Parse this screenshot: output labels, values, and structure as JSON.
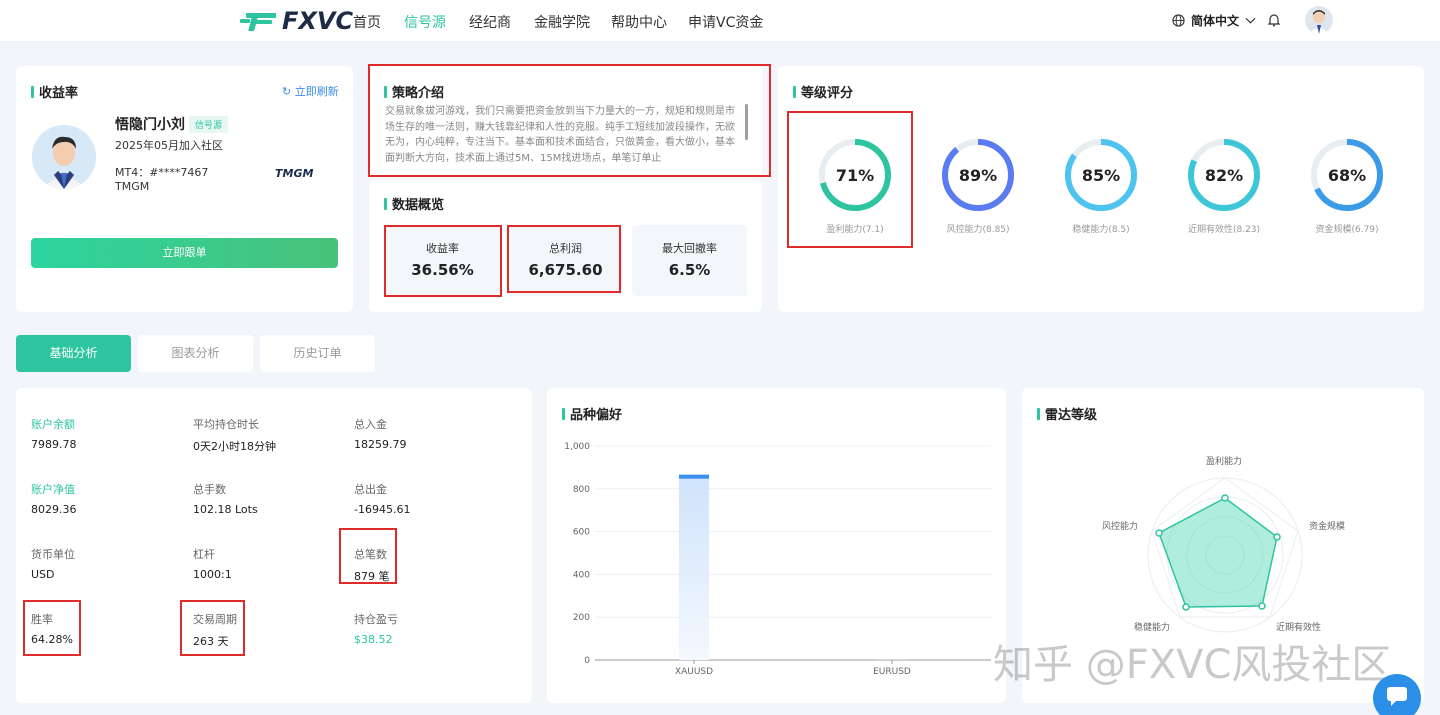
{
  "nav": {
    "logo_text": "FXVC",
    "items": [
      "首页",
      "信号源",
      "经纪商",
      "金融学院",
      "帮助中心",
      "申请VC资金"
    ],
    "active_index": 1,
    "language": "简体中文"
  },
  "profile": {
    "title": "收益率",
    "refresh_label": "立即刷新",
    "name": "悟隐门小刘",
    "tag": "信号源",
    "joined": "2025年05月加入社区",
    "account": "MT4：#****7467",
    "broker": "TMGM",
    "broker_logo": "TMGM",
    "follow_button": "立即跟单"
  },
  "strategy": {
    "title": "策略介绍",
    "text": "交易就象拔河游戏，我们只需要把资金放到当下力量大的一方，规矩和规则是市场生存的唯一法则，赚大钱靠纪律和人性的克服。纯手工短线加波段操作，无欲无为，内心纯粹，专注当下。基本面和技术面结合，只做黄金，看大做小，基本面判断大方向，技术面上通过5M、15M找进场点，单笔订单止"
  },
  "overview": {
    "title": "数据概览",
    "stats": [
      {
        "label": "收益率",
        "value": "36.56%"
      },
      {
        "label": "总利润",
        "value": "6,675.60"
      },
      {
        "label": "最大回撤率",
        "value": "6.5%"
      }
    ]
  },
  "rating": {
    "title": "等级评分",
    "gauges": [
      {
        "value": "71%",
        "percent": 71,
        "label": "盈利能力(7.1)",
        "color": "#2ec4a0"
      },
      {
        "value": "89%",
        "percent": 89,
        "label": "风控能力(8.85)",
        "color": "#5b7cf0"
      },
      {
        "value": "85%",
        "percent": 85,
        "label": "稳健能力(8.5)",
        "color": "#4fc3f0"
      },
      {
        "value": "82%",
        "percent": 82,
        "label": "近期有效性(8.23)",
        "color": "#3cc6d8"
      },
      {
        "value": "68%",
        "percent": 68,
        "label": "资金规模(6.79)",
        "color": "#3a9ce8"
      }
    ]
  },
  "tabs": [
    "基础分析",
    "图表分析",
    "历史订单"
  ],
  "metrics": [
    {
      "label": "账户余额",
      "value": "7989.78"
    },
    {
      "label": "平均持仓时长",
      "value": "0天2小时18分钟"
    },
    {
      "label": "总入金",
      "value": "18259.79"
    },
    {
      "label": "账户净值",
      "value": "8029.36"
    },
    {
      "label": "总手数",
      "value": "102.18 Lots"
    },
    {
      "label": "总出金",
      "value": "-16945.61"
    },
    {
      "label": "货币单位",
      "value": "USD"
    },
    {
      "label": "杠杆",
      "value": "1000:1"
    },
    {
      "label": "总笔数",
      "value": "879 笔"
    },
    {
      "label": "胜率",
      "value": "64.28%"
    },
    {
      "label": "交易周期",
      "value": "263 天"
    },
    {
      "label": "持仓盈亏",
      "value": "$38.52"
    }
  ],
  "preference": {
    "title": "品种偏好"
  },
  "radar": {
    "title": "雷达等级",
    "axes": [
      "盈利能力",
      "资金规模",
      "近期有效性",
      "稳健能力",
      "风控能力"
    ]
  },
  "chart_data": {
    "type": "bar",
    "title": "品种偏好",
    "categories": [
      "XAUUSD",
      "EURUSD"
    ],
    "values": [
      866,
      1
    ],
    "yticks": [
      "0",
      "200",
      "400",
      "600",
      "800",
      "1,000"
    ],
    "ylim": [
      0,
      1000
    ],
    "grid": true
  },
  "watermark": "知乎 @FXVC风投社区"
}
